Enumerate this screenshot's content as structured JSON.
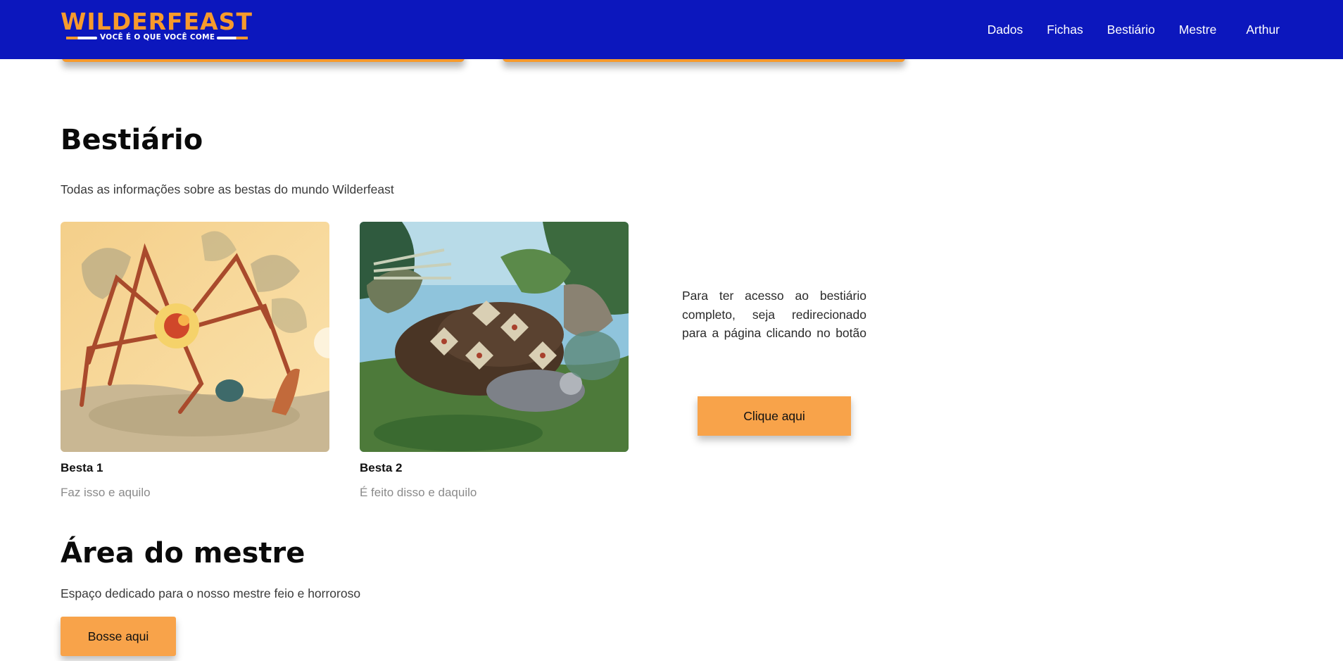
{
  "header": {
    "logo_title": "WILDERFEAST",
    "logo_subtitle": "VOCÊ É O QUE VOCÊ COME",
    "nav": [
      {
        "label": "Dados"
      },
      {
        "label": "Fichas"
      },
      {
        "label": "Bestiário"
      },
      {
        "label": "Mestre"
      }
    ],
    "user": "Arthur"
  },
  "bestiario": {
    "title": "Bestiário",
    "description": "Todas as informações sobre as bestas do mundo Wilderfeast",
    "beasts": [
      {
        "name": "Besta 1",
        "description": "Faz isso e aquilo"
      },
      {
        "name": "Besta 2",
        "description": "É feito disso e daquilo"
      }
    ],
    "access_text": "Para ter acesso ao bestiário completo, seja redirecionado para a página clicando no botão",
    "button_label": "Clique aqui"
  },
  "mestre": {
    "title": "Área do mestre",
    "description": "Espaço dedicado para o nosso mestre feio e horroroso",
    "button_label": "Bosse aqui"
  },
  "colors": {
    "header_bg": "#0c17bd",
    "accent": "#f79a2c",
    "button_bg": "#f8a34a"
  }
}
